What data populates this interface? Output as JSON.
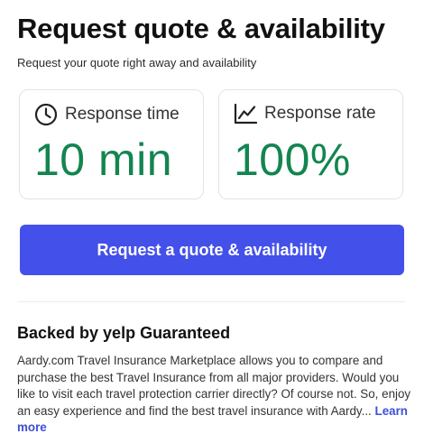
{
  "header": {
    "title": "Request quote & availability",
    "subtitle": "Request your quote right away and availability"
  },
  "stats": [
    {
      "icon": "clock-icon",
      "label": "Response time",
      "value": "10 min"
    },
    {
      "icon": "trend-chart-icon",
      "label": "Response rate",
      "value": "100%"
    }
  ],
  "cta": {
    "label": "Request a quote & availability"
  },
  "guarantee": {
    "title": "Backed by yelp Guaranteed",
    "description": "Aardy.com Travel Insurance Marketplace allows you to compare and purchase the best Travel Insurance from all major providers. Would you like to visit each travel protection carrier directly? Of course not. So, enjoy an easy experience and find the best travel insurance with Aardy...",
    "learn_more": "Learn more"
  },
  "colors": {
    "accent": "#4350ea",
    "stat_value": "#138550",
    "link": "#3d4fd6"
  }
}
